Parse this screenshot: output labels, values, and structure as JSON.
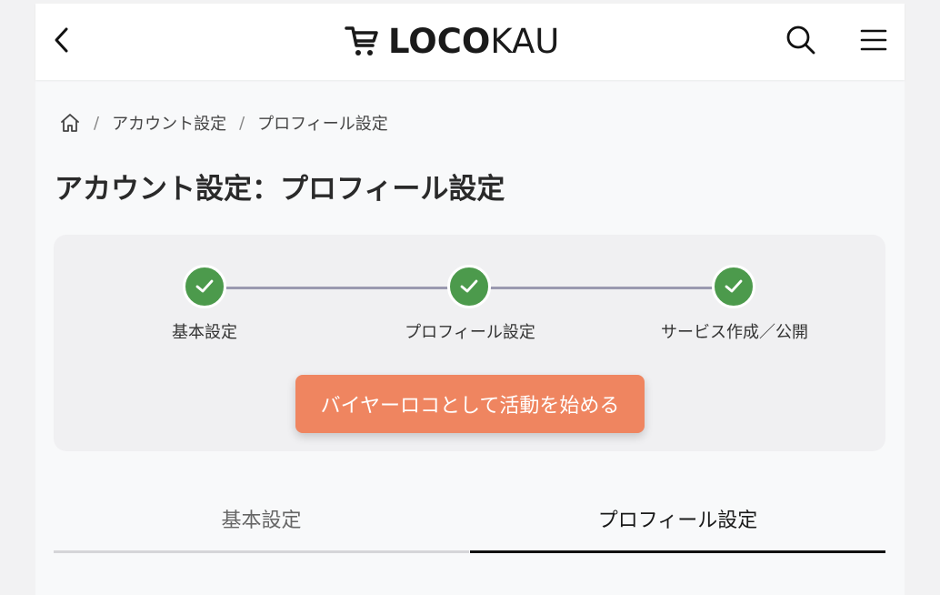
{
  "header": {
    "logo_bold": "LOCO",
    "logo_light": "KAU",
    "back_icon": "chevron-left-icon",
    "search_icon": "search-icon",
    "menu_icon": "hamburger-menu-icon"
  },
  "breadcrumb": {
    "home_icon": "home-icon",
    "separator": "/",
    "items": [
      "アカウント設定",
      "プロフィール設定"
    ]
  },
  "page_title": "アカウント設定：プロフィール設定",
  "steps": {
    "items": [
      {
        "label": "基本設定",
        "status": "complete"
      },
      {
        "label": "プロフィール設定",
        "status": "complete"
      },
      {
        "label": "サービス作成／公開",
        "status": "complete"
      }
    ],
    "complete_color": "#4c9a4c",
    "line_color": "#9a99b0"
  },
  "cta": {
    "label": "バイヤーロコとして活動を始める",
    "color": "#ef8560"
  },
  "tabs": {
    "items": [
      {
        "label": "基本設定",
        "active": false
      },
      {
        "label": "プロフィール設定",
        "active": true
      }
    ]
  }
}
